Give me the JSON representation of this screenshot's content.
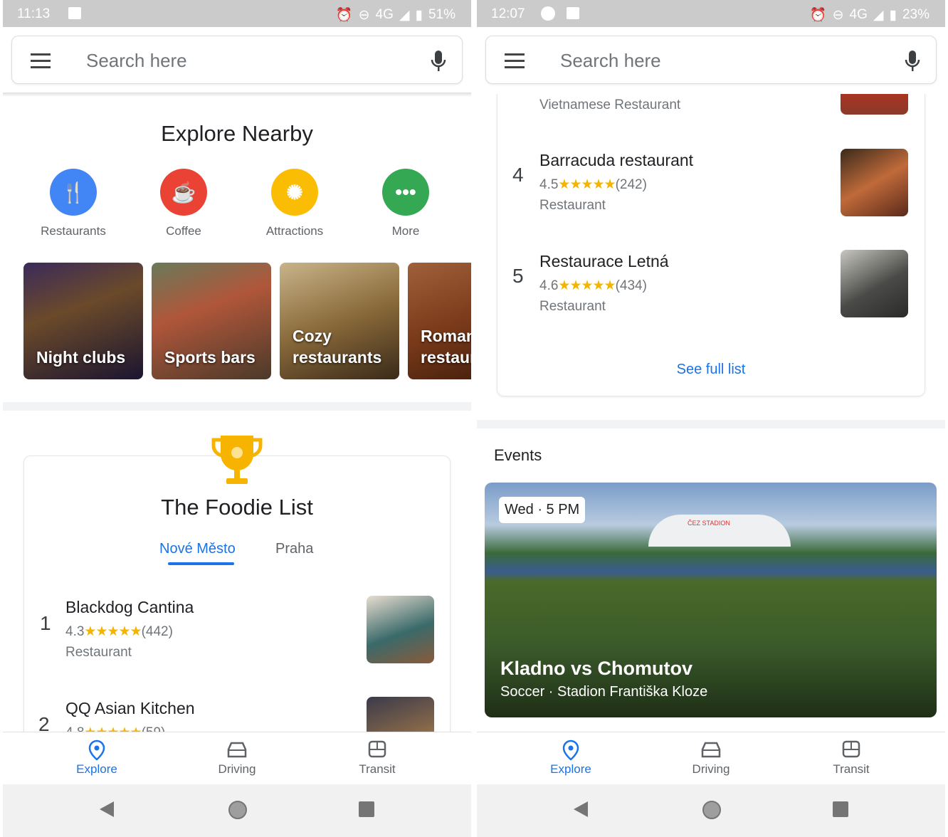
{
  "left": {
    "status": {
      "time": "11:13",
      "battery": "51%",
      "network": "4G"
    },
    "search": {
      "placeholder": "Search here"
    },
    "explore": {
      "title": "Explore Nearby",
      "categories": [
        {
          "label": "Restaurants",
          "icon": "fork-knife-icon",
          "color": "#4285f4"
        },
        {
          "label": "Coffee",
          "icon": "coffee-cup-icon",
          "color": "#ea4335"
        },
        {
          "label": "Attractions",
          "icon": "ferris-wheel-icon",
          "color": "#fbbc04"
        },
        {
          "label": "More",
          "icon": "more-dots-icon",
          "color": "#34a853"
        }
      ],
      "cards": [
        {
          "label": "Night clubs"
        },
        {
          "label": "Sports bars"
        },
        {
          "label": "Cozy restaurants"
        },
        {
          "label": "Romantic restaurants"
        }
      ]
    },
    "foodie": {
      "title": "The Foodie List",
      "tabs": [
        {
          "label": "Nové Město",
          "active": true
        },
        {
          "label": "Praha",
          "active": false
        }
      ],
      "items": [
        {
          "rank": "1",
          "name": "Blackdog Cantina",
          "rating": "4.3",
          "stars": "★★★★★",
          "reviews": "(442)",
          "type": "Restaurant"
        },
        {
          "rank": "2",
          "name": "QQ Asian Kitchen",
          "rating": "4.8",
          "stars": "★★★★★",
          "reviews": "(59)"
        }
      ]
    },
    "nav": {
      "explore": "Explore",
      "driving": "Driving",
      "transit": "Transit"
    }
  },
  "right": {
    "status": {
      "time": "12:07",
      "battery": "23%",
      "network": "4G"
    },
    "search": {
      "placeholder": "Search here"
    },
    "list": {
      "prev_type": "Vietnamese Restaurant",
      "items": [
        {
          "rank": "4",
          "name": "Barracuda restaurant",
          "rating": "4.5",
          "stars": "★★★★★",
          "reviews": "(242)",
          "type": "Restaurant"
        },
        {
          "rank": "5",
          "name": "Restaurace Letná",
          "rating": "4.6",
          "stars": "★★★★★",
          "reviews": "(434)",
          "type": "Restaurant"
        }
      ],
      "see_full": "See full list"
    },
    "events": {
      "title": "Events",
      "card": {
        "time": "Wed · 5 PM",
        "title": "Kladno vs Chomutov",
        "subtitle": "Soccer · Stadion Františka Kloze",
        "sign": "ČEZ STADION"
      }
    },
    "nav": {
      "explore": "Explore",
      "driving": "Driving",
      "transit": "Transit"
    }
  },
  "colors": {
    "accent": "#1a73e8",
    "star": "#f4b400"
  }
}
